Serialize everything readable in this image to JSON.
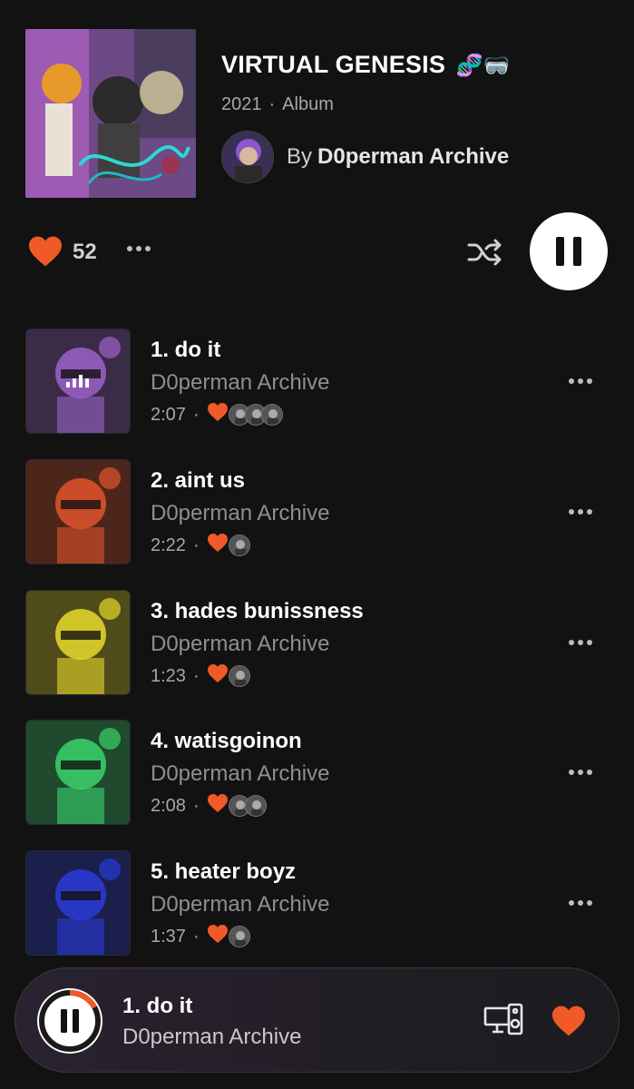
{
  "album": {
    "title": "VIRTUAL GENESIS",
    "title_emoji": "🧬🥽",
    "year": "2021",
    "type": "Album",
    "by_label": "By",
    "artist": "D0perman Archive",
    "cover_icon": "album-art-collage"
  },
  "actions": {
    "like_count": "52",
    "like_icon": "heart-icon",
    "more_icon": "ellipsis-icon",
    "shuffle_icon": "shuffle-icon",
    "play_state_icon": "pause-icon"
  },
  "tracks": [
    {
      "title": "1. do it",
      "artist": "D0perman Archive",
      "duration": "2:07",
      "likers": 3,
      "thumb_tint": "#9b63c9",
      "now_playing": true
    },
    {
      "title": "2. aint us",
      "artist": "D0perman Archive",
      "duration": "2:22",
      "likers": 1,
      "thumb_tint": "#e0542a",
      "now_playing": false
    },
    {
      "title": "3. hades bunissness",
      "artist": "D0perman Archive",
      "duration": "1:23",
      "likers": 1,
      "thumb_tint": "#e6d92a",
      "now_playing": false
    },
    {
      "title": "4. watisgoinon",
      "artist": "D0perman Archive",
      "duration": "2:08",
      "likers": 2,
      "thumb_tint": "#39d36b",
      "now_playing": false
    },
    {
      "title": "5. heater boyz",
      "artist": "D0perman Archive",
      "duration": "1:37",
      "likers": 1,
      "thumb_tint": "#2a3bd9",
      "now_playing": false
    }
  ],
  "mini_player": {
    "title": "1. do it",
    "artist": "D0perman Archive",
    "progress": 0.17,
    "device_icon": "device-connect-icon",
    "like_icon": "heart-icon"
  },
  "colors": {
    "accent": "#f05a28",
    "background": "#121212",
    "muted_text": "#8f8f8f"
  }
}
